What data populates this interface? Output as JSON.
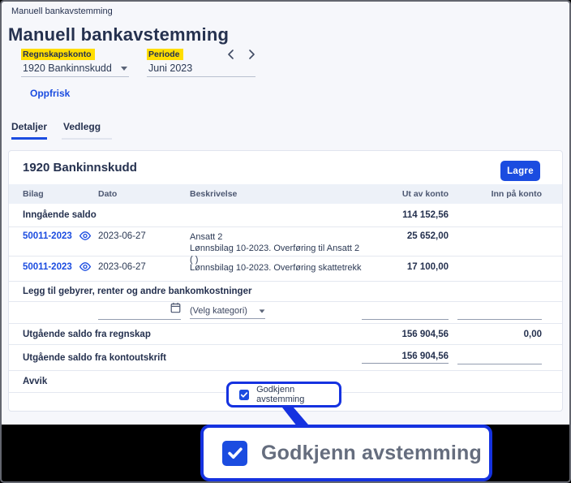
{
  "breadcrumb": "Manuell bankavstemming",
  "page_title": "Manuell bankavstemming",
  "filters": {
    "account": {
      "label": "Regnskapskonto",
      "value": "1920 Bankinnskudd"
    },
    "period": {
      "label": "Periode",
      "value": "Juni 2023"
    }
  },
  "refresh_label": "Oppfrisk",
  "tabs": [
    {
      "label": "Detaljer",
      "active": true
    },
    {
      "label": "Vedlegg",
      "active": false
    }
  ],
  "card": {
    "title": "1920 Bankinnskudd",
    "save_label": "Lagre",
    "table": {
      "headers": [
        "Bilag",
        "Dato",
        "Beskrivelse",
        "Ut av konto",
        "Inn på konto"
      ],
      "opening": {
        "label": "Inngående saldo",
        "out": "114 152,56"
      },
      "entries": [
        {
          "bilag": "50011-2023",
          "dato": "2023-06-27",
          "desc1": "Ansatt 2",
          "desc2": "Lønnsbilag 10-2023. Overføring til Ansatt 2 ( )",
          "out": "25 652,00",
          "in": ""
        },
        {
          "bilag": "50011-2023",
          "dato": "2023-06-27",
          "desc1": "Lønnsbilag 10-2023. Overføring skattetrekk",
          "out": "17 100,00",
          "in": ""
        }
      ],
      "fees_label": "Legg til gebyrer, renter og andre bankomkostninger",
      "category_placeholder": "(Velg kategori)",
      "ledger": {
        "label": "Utgående saldo fra regnskap",
        "out": "156 904,56",
        "in": "0,00"
      },
      "statement": {
        "label": "Utgående saldo fra kontoutskrift",
        "out": "156 904,56",
        "in": ""
      },
      "deviation": {
        "label": "Avvik"
      },
      "approve": {
        "label": "Godkjenn avstemming",
        "checked": true
      }
    }
  },
  "callout": {
    "label": "Godkjenn avstemming",
    "checked": true
  },
  "icons": [
    "eye-icon",
    "calendar-icon",
    "chevron-left-icon",
    "chevron-right-icon",
    "caret-down-icon",
    "check-icon"
  ],
  "colors": {
    "accent_blue": "#1b4ce0",
    "annotation_blue": "#1532e0",
    "highlight_yellow": "#ffdd00",
    "page_bg": "#f6f7fb",
    "table_header_bg": "#edf1f8",
    "text_navy": "#25314f",
    "black_backdrop": "#000000"
  }
}
